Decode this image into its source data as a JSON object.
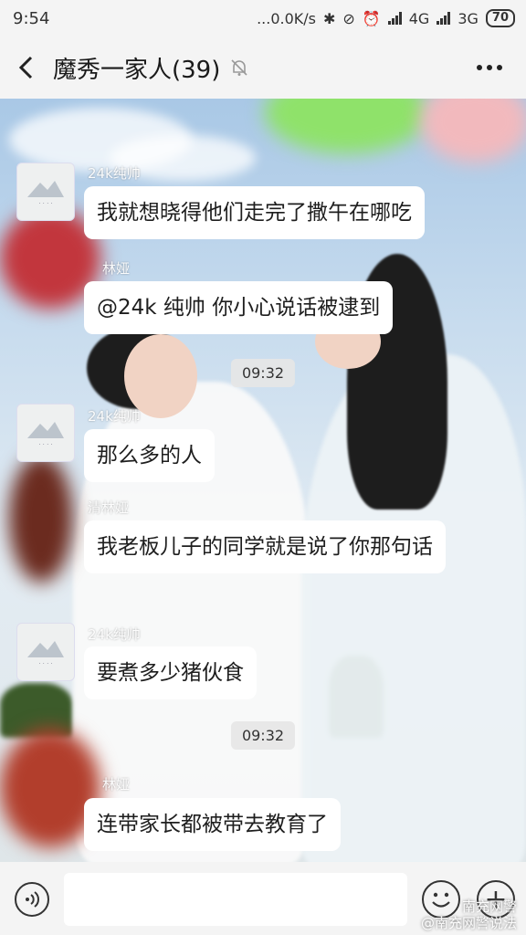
{
  "status_bar": {
    "time": "9:54",
    "net_speed": "...0.0K/s",
    "network_1": "4G",
    "network_2": "3G",
    "battery": "70"
  },
  "header": {
    "title": "魔秀一家人(39)"
  },
  "messages": [
    {
      "sender": "24k纯帅",
      "text": "我就想晓得他们走完了撒午在哪吃"
    },
    {
      "sender": "林娅",
      "text": "@24k 纯帅  你小心说话被逮到"
    },
    {
      "time": "09:32"
    },
    {
      "sender": "24k纯帅",
      "text": "那么多的人"
    },
    {
      "sender": "清林娅",
      "text": "我老板儿子的同学就是说了你那句话"
    },
    {
      "sender": "24k纯帅",
      "text": "要煮多少猪伙食"
    },
    {
      "time": "09:32"
    },
    {
      "sender": "林娅",
      "text": "连带家长都被带去教育了"
    }
  ],
  "watermark": {
    "line1": "南充网警",
    "line2": "@南充网警说法"
  },
  "icons": {
    "back": "chevron-left-icon",
    "mute": "bell-off-icon",
    "more": "more-dots-icon",
    "voice": "voice-icon",
    "emoji": "emoji-icon",
    "plus": "plus-icon"
  },
  "colors": {
    "bubble": "#ffffff",
    "bar": "#f4f4f4",
    "text": "#1e1e1e"
  }
}
